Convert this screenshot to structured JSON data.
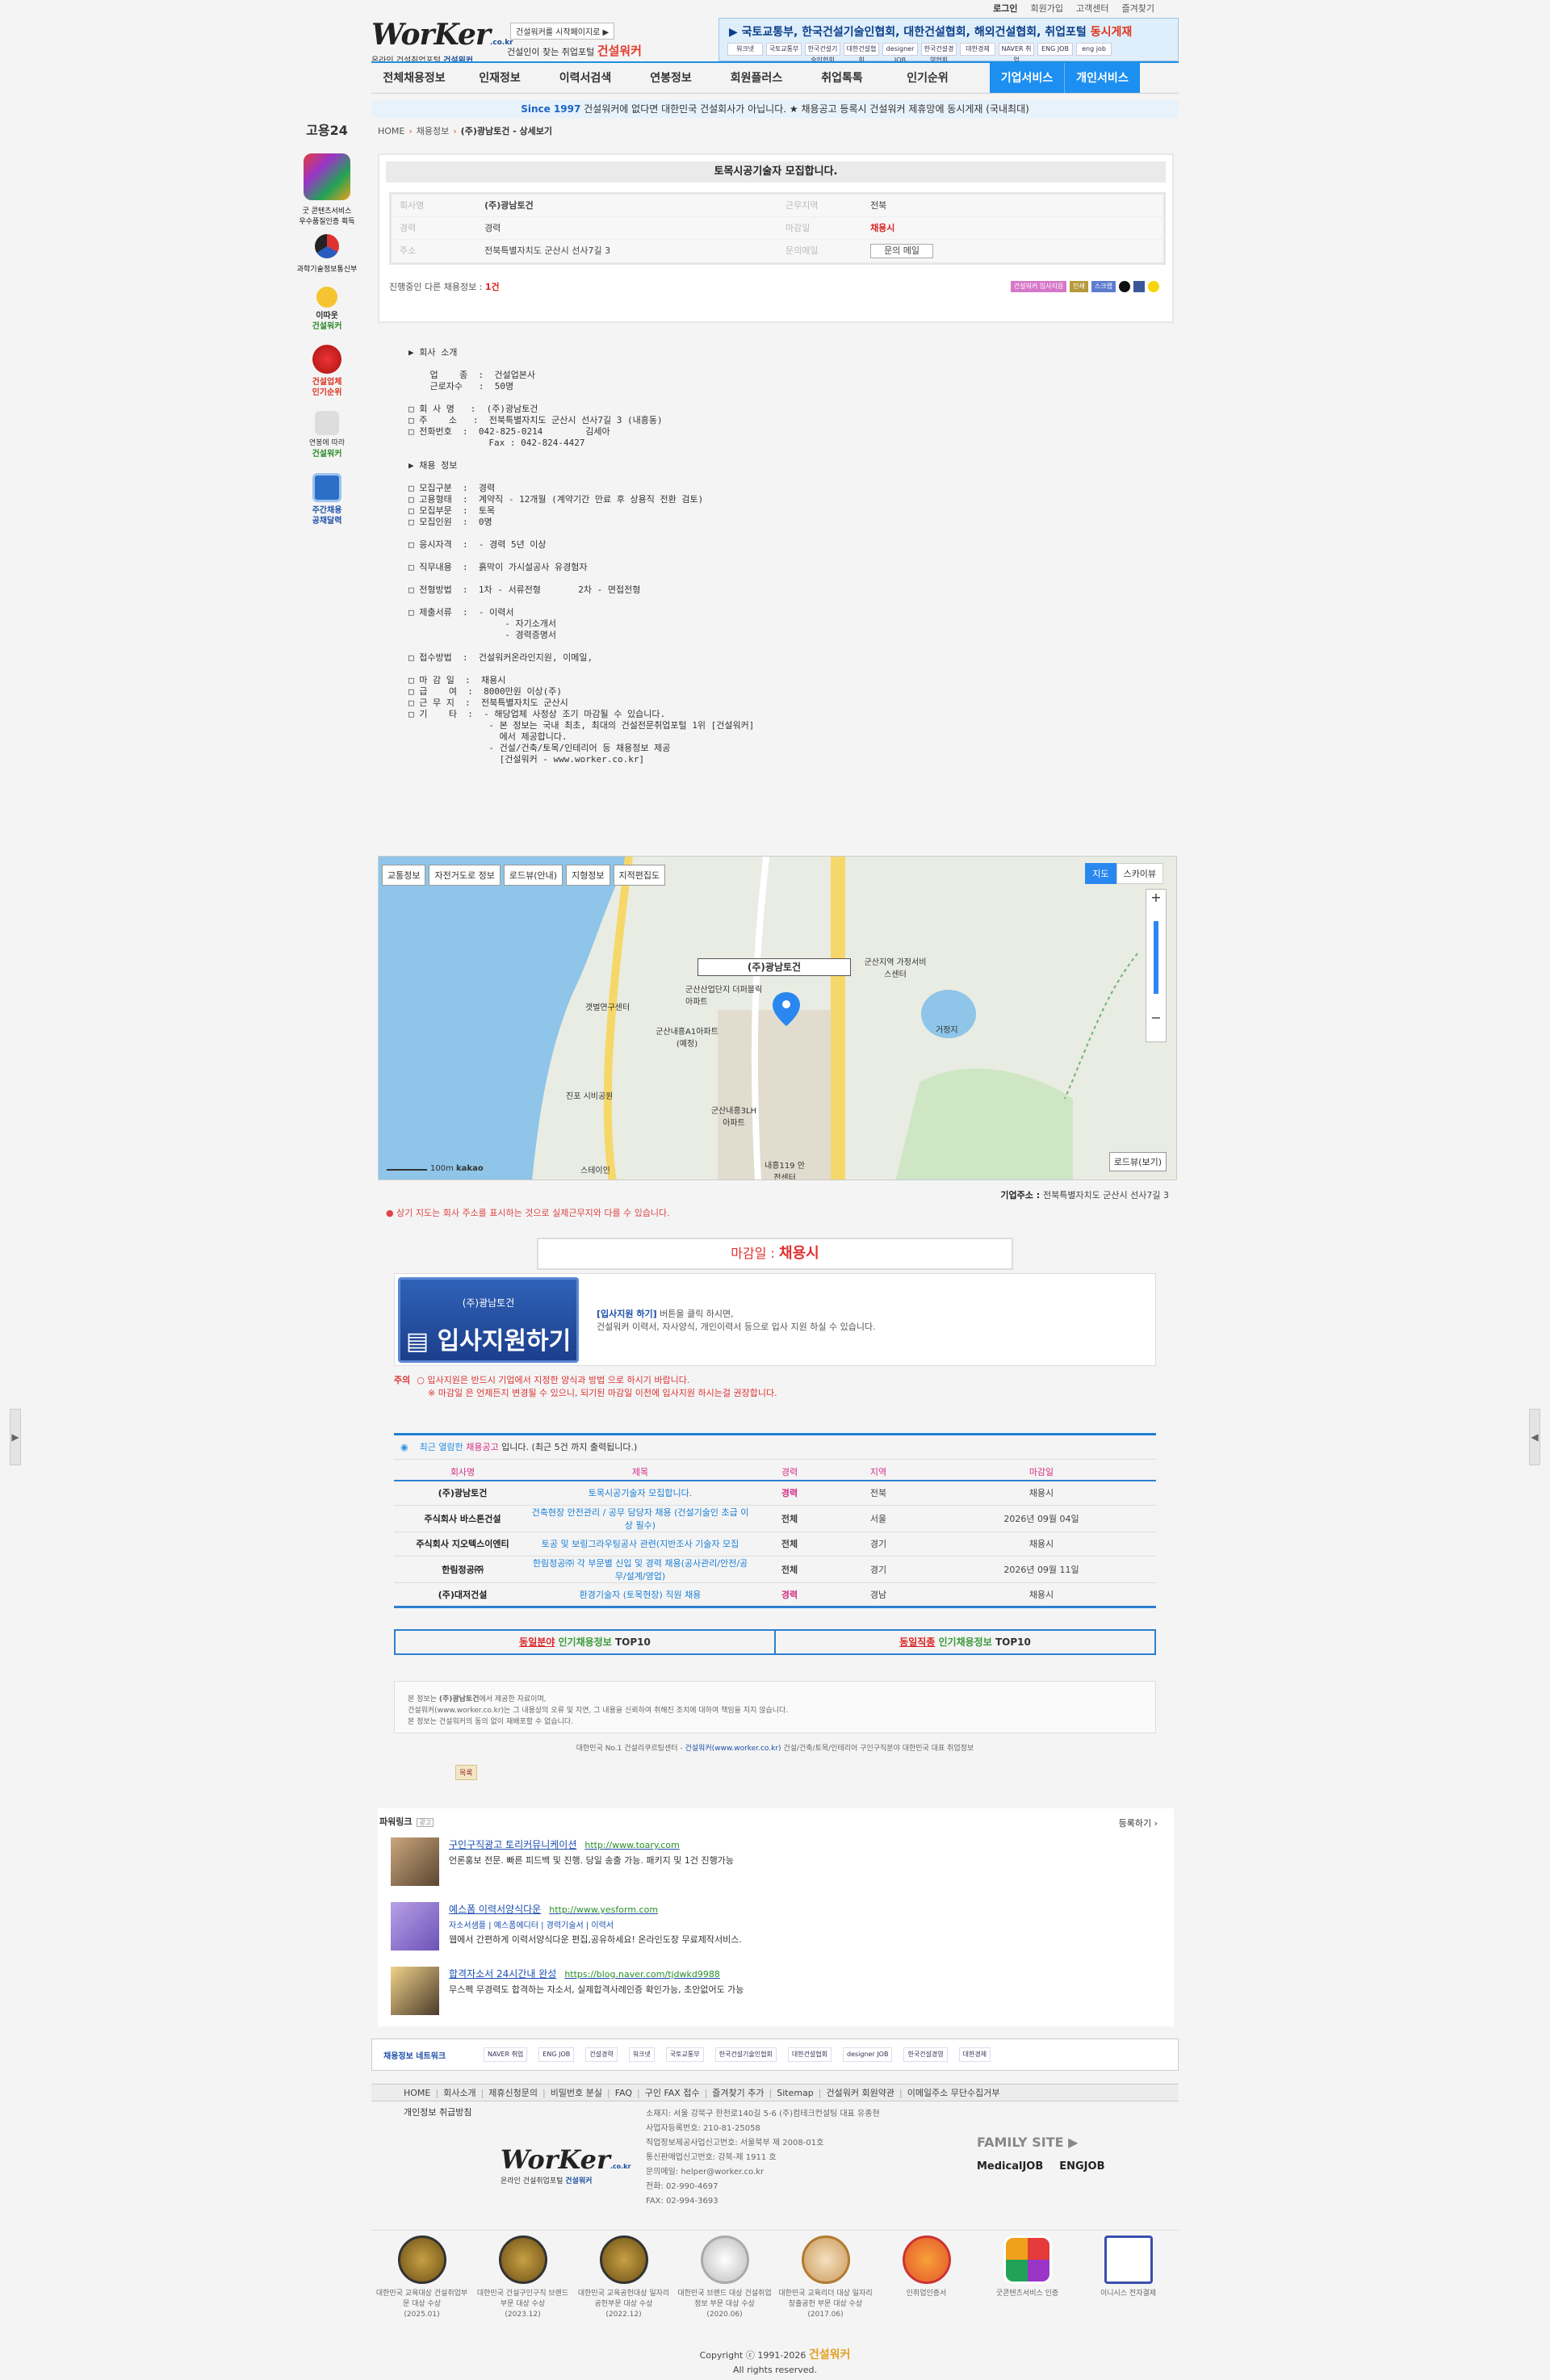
{
  "header": {
    "logo": "WorKer",
    "logo_domain": ".co.kr",
    "logo_sub_a": "온라인 건설취업포털",
    "logo_sub_b": "건설워커",
    "badge": "건설워커를 시작페이지로 ▶",
    "slogan_a": "건설인이 찾는 취업포털",
    "slogan_b": "건설워커",
    "top_menu": [
      "로그인",
      "회원가입",
      "고객센터",
      "즐겨찾기"
    ],
    "banner_text": "▶ 국토교통부, 한국건설기술인협회, 대한건설협회, 해외건설협회, 취업포털 ",
    "banner_highlight": "동시게재",
    "banner_logos": [
      "워크넷",
      "국토교통부",
      "한국건설기술인협회",
      "대한건설협회",
      "designer JOB",
      "한국건설경영협회",
      "대한경제",
      "NAVER 취업",
      "ENG JOB",
      "eng job"
    ]
  },
  "nav": [
    "전체채용정보",
    "인재정보",
    "이력서검색",
    "연봉정보",
    "회원플러스",
    "취업톡톡",
    "인기순위",
    "기업서비스",
    "개인서비스"
  ],
  "notice": {
    "since": "Since 1997",
    "text": " 건설워커에 없다면 대한민국 건설회사가 아닙니다. ★ 채용공고 등록시 건설워커 제휴망에 동시게재 (국내최대)"
  },
  "side": {
    "g24": "고용24",
    "award_a": "굿 콘텐츠서비스",
    "award_b": "우수품질인증 획득",
    "ministry": "과학기술정보통신부",
    "who": "이따웃",
    "who2": "건설워커",
    "rank_a": "건설업체",
    "rank_b": "인기순위",
    "salary_a": "연봉에 따라",
    "salary_b": "건설워커",
    "weekly_a": "주간채용",
    "weekly_b": "공채달력"
  },
  "breadcrumb": {
    "home": "HOME",
    "level1": "채용정보",
    "current": "(주)광남토건 - 상세보기"
  },
  "job": {
    "title": "토목시공기술자 모집합니다.",
    "rows": [
      {
        "k1": "회사명",
        "v1": "(주)광남토건",
        "k2": "근무지역",
        "v2": "전북"
      },
      {
        "k1": "경력",
        "v1": "경력",
        "k2": "마감일",
        "v2": "채용시"
      },
      {
        "k1": "주소",
        "v1": "전북특별자치도 군산시 선사7길 3",
        "k2": "문의메일",
        "v2": "문의 메일"
      }
    ],
    "other_prefix": "진행중인 다른 채용정보 : ",
    "other_count": "1건",
    "tools": [
      "건설워커 입사지원",
      "인쇄",
      "스크랩"
    ]
  },
  "body_text": "▶ 회사 소개\n\n    업    종  :  건설업본사\n    근로자수   :  50명\n\n□ 회 사 명   :  (주)광남토건\n□ 주    소   :  전북특별자치도 군산시 선사7길 3 (내흥동)\n□ 전화번호  :  042-825-0214        김세아\n               Fax : 042-824-4427\n\n▶ 채용 정보\n\n□ 모집구분  :  경력\n□ 고용형태  :  계약직 - 12개월 (계약기간 만료 후 상용직 전환 검토)\n□ 모집부문  :  토목\n□ 모집인원  :  0명\n\n□ 응시자격  :  - 경력 5년 이상\n\n□ 직무내용  :  흙막이 가시설공사 유경험자\n\n□ 전형방법  :  1차 - 서류전형       2차 - 면접전형\n\n□ 제출서류  :  - 이력서\n                  - 자기소개서\n                  - 경력증명서\n\n□ 접수방법  :  건설워커온라인지원, 이메일,\n\n□ 마 감 일  :  채용시\n□ 급    여  :  8000만원 이상(주)\n□ 근 무 지  :  전북특별자치도 군산시\n□ 기    타  :  - 해당업체 사정상 조기 마감될 수 있습니다.\n               - 본 정보는 국내 최초, 최대의 건설전문취업포털 1위 [건설워커]\n                 에서 제공합니다.\n               - 건설/건축/토목/인테리어 등 채용정보 제공\n                 [건설워커 - www.worker.co.kr]",
  "map": {
    "buttons": [
      "교통정보",
      "자전거도로 정보",
      "로드뷰(안내)",
      "지형정보",
      "지적편집도"
    ],
    "types": [
      "지도",
      "스카이뷰"
    ],
    "pin": "(주)광남토건",
    "labels": [
      "군산지역 가정서비스센터",
      "갯벌연구센터",
      "군산내흥A1아파트 (예정)",
      "군산내흥3LH 아파트",
      "진포 시비공원",
      "스테이인",
      "내흥119 안전센터",
      "거정지",
      "군산산업단지 더퍼블릭아파트"
    ],
    "scale": "100m",
    "brand": "kakao",
    "roadview": "로드뷰(보기)",
    "addr_label": "기업주소 : ",
    "addr": "전북특별자치도 군산시 선사7길 3",
    "note": "상기 지도는 회사 주소를 표시하는 것으로 실제근무지와 다를 수 있습니다."
  },
  "deadline": {
    "label": "마감일 : ",
    "value": "채용시"
  },
  "apply": {
    "company": "(주)광남토건",
    "button": "입사지원하기",
    "line1_b": "[입사지원 하기]",
    "line1": " 버튼을 클릭 하시면,",
    "line2": "건설워커 이력서, 자사양식, 개인이력서 등으로 입사 지원 하실 수 있습니다.",
    "warn_label": "주의",
    "warn1": "입사지원은 반드시 기업에서 지정한 양식과 방법 으로 하시기 바랍니다.",
    "warn2": "※ 마감일 은 언제든지 변경될 수 있으니, 되기된 마감일 이전에 입사지원 하시는걸 권장합니다."
  },
  "recent": {
    "head_a": "최근 열람한 ",
    "head_b": "채용공고",
    "head_c": " 입니다.   (최근 5건 까지 출력됩니다.)",
    "columns": [
      "회사명",
      "제목",
      "경력",
      "지역",
      "마감일"
    ],
    "rows": [
      {
        "company": "(주)광남토건",
        "title": "토목시공기술자 모집합니다.",
        "exp": "경력",
        "area": "전북",
        "due": "채용시"
      },
      {
        "company": "주식회사 바스톤건설",
        "title": "건축현장 안전관리 / 공무 담당자 채용 (건설기술인 초급 이상 필수)",
        "exp": "전체",
        "area": "서울",
        "due": "2026년 09월 04일"
      },
      {
        "company": "주식회사 지오텍스이엔티",
        "title": "토공 및 보링그라우팅공사 관련(지반조사 기술자 모집",
        "exp": "전체",
        "area": "경기",
        "due": "채용시"
      },
      {
        "company": "한림정공㈜",
        "title": "한림정공㈜ 각 부문별 신입 및 경력 채용(공사관리/안전/공무/설계/영업)",
        "exp": "전체",
        "area": "경기",
        "due": "2026년 09월 11일"
      },
      {
        "company": "(주)대저건설",
        "title": "환경기술자 (토목현장) 직원 채용",
        "exp": "경력",
        "area": "경남",
        "due": "채용시"
      }
    ]
  },
  "top10": {
    "a_red": "동일분야",
    "a_green": " 인기채용정보",
    "a_tail": " TOP10",
    "b_red": "동일직종",
    "b_green": " 인기채용정보",
    "b_tail": " TOP10"
  },
  "disclaimer": {
    "l1_a": "본 정보는 ",
    "l1_b": "(주)광남토건",
    "l1_c": "에서 제공한 자료이며,",
    "l2": "건설워커(www.worker.co.kr)는 그 내용상의 오류 및 지연, 그 내용을 신뢰하여 취해진 조치에 대하여 책임을 지지 않습니다.",
    "l3": "본 정보는 건설워커의 동의 없이 재배포할 수 없습니다."
  },
  "foot1_a": "대한민국 No.1 건설리쿠르팅센터 - ",
  "foot1_b": "건설워커(www.worker.co.kr)",
  "foot1_c": " 건설/건축/토목/인테리어 구인구직분야 대한민국 대표 취업정보",
  "list_btn": "목록",
  "powerlink": {
    "title": "파워링크",
    "ad": "광고",
    "register": "등록하기 ›",
    "items": [
      {
        "title": "구인구직광고 토리커뮤니케이션",
        "url": "http://www.toary.com",
        "desc": "언론홍보 전문. 빠른 피드백 및 진행. 당일 송출 가능. 패키지 및 1건 진행가능",
        "links": ""
      },
      {
        "title": "예스폼 이력서양식다운",
        "url": "http://www.yesform.com",
        "desc": "웹에서 간편하게 이력서양식다운 편집,공유하세요! 온라인도장 무료제작서비스.",
        "links": "자소서샘플 | 예스폼에디터 | 경력기술서 | 이력서"
      },
      {
        "title": "합격자소서 24시간내 완성",
        "url": "https://blog.naver.com/tjdwkd9988",
        "desc": "무스펙 무경력도 합격하는 자소서, 실제합격사례인증 확인가능, 초안없어도 가능",
        "links": ""
      }
    ]
  },
  "partners": {
    "label": "채용정보 네트워크",
    "items": [
      "NAVER 취업",
      "ENG JOB",
      "건설경력",
      "워크넷",
      "국토교통부",
      "한국건설기술인협회",
      "대한건설협회",
      "designer JOB",
      "한국건설경영",
      "대한경제"
    ]
  },
  "footer_nav": [
    "HOME",
    "회사소개",
    "제휴신청문의",
    "비밀번호 분실",
    "FAQ",
    "구인 FAX 접수",
    "즐겨찾기 추가",
    "Sitemap",
    "건설워커 회원약관",
    "이메일주소 무단수집거부"
  ],
  "privacy": "개인정보 취급방침",
  "footer_info": [
    "소재지: 서울 강북구 한천로140길 5-6 (주)컴테크컨설팅 대표 유종현",
    "사업자등록번호: 210-81-25058",
    "직업정보제공사업신고번호: 서울북부 제 2008-01호",
    "통신판매업신고번호: 강북-제 1911 호",
    "문의메일: helper@worker.co.kr",
    "전화: 02-990-4697",
    "FAX: 02-994-3693"
  ],
  "family": "FAMILY SITE ▶",
  "family_sites": [
    "MedicalJOB",
    "ENGJOB"
  ],
  "awards": [
    {
      "t": "대한민국 교육대상 건설취업부문 대상 수상",
      "y": "(2025.01)"
    },
    {
      "t": "대한민국 건설구인구직 브랜드부문 대상 수상",
      "y": "(2023.12)"
    },
    {
      "t": "대한민국 교육공헌대상 일자리 공헌부문 대상 수상",
      "y": "(2022.12)"
    },
    {
      "t": "대한민국 브랜드 대상 건설취업정보 부문 대상 수상",
      "y": "(2020.06)"
    },
    {
      "t": "대한민국 교육리더 대상 일자리창출공헌 부문 대상 수상",
      "y": "(2017.06)"
    },
    {
      "t": "인취업인증서",
      "y": ""
    },
    {
      "t": "굿콘텐츠서비스 인증",
      "y": ""
    },
    {
      "t": "이니시스 전자결제",
      "y": ""
    }
  ],
  "copyright_a": "Copyright ⓒ 1991-2026 ",
  "copyright_b": "건설워커",
  "copyright_c": "All rights reserved."
}
